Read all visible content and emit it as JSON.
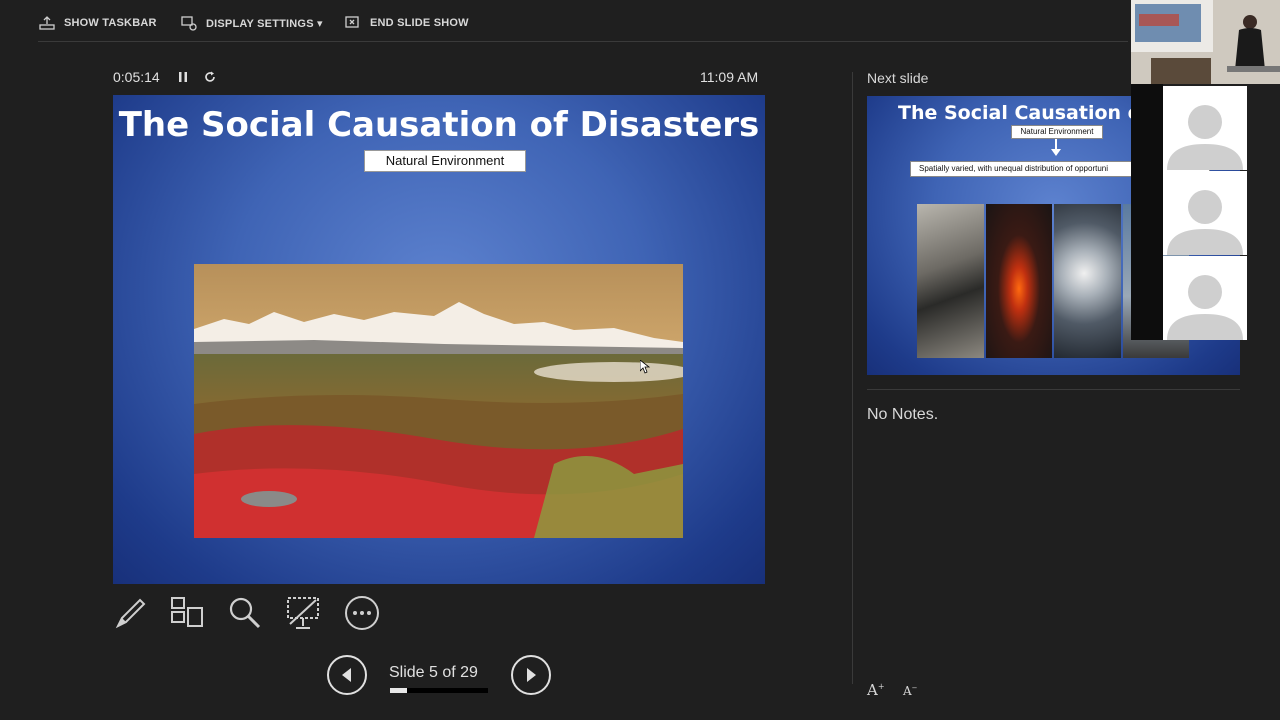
{
  "toolbar": {
    "show_taskbar": "SHOW TASKBAR",
    "display_settings": "DISPLAY SETTINGS ▾",
    "end_slide_show": "END SLIDE SHOW"
  },
  "status": {
    "timer": "0:05:14",
    "clock": "11:09 AM"
  },
  "current_slide": {
    "title": "The Social Causation of Disasters",
    "label": "Natural Environment"
  },
  "next_slide": {
    "heading": "Next slide",
    "title": "The Social Causation of D",
    "label": "Natural Environment",
    "subtitle": "Spatially varied, with unequal distribution of opportuni"
  },
  "notes": {
    "text": "No Notes."
  },
  "navigation": {
    "slide_count": "Slide 5 of 29",
    "current": 5,
    "total": 29
  },
  "font_controls": {
    "increase": "A",
    "decrease": "A"
  },
  "icons": [
    "pen-icon",
    "see-all-slides-icon",
    "zoom-icon",
    "black-screen-icon",
    "more-options-icon",
    "previous-icon",
    "next-icon",
    "pause-icon",
    "restart-icon"
  ],
  "colors": {
    "background": "#1f1f1f",
    "slide_blue": "#3f64b5",
    "text": "#e6e6e6"
  }
}
